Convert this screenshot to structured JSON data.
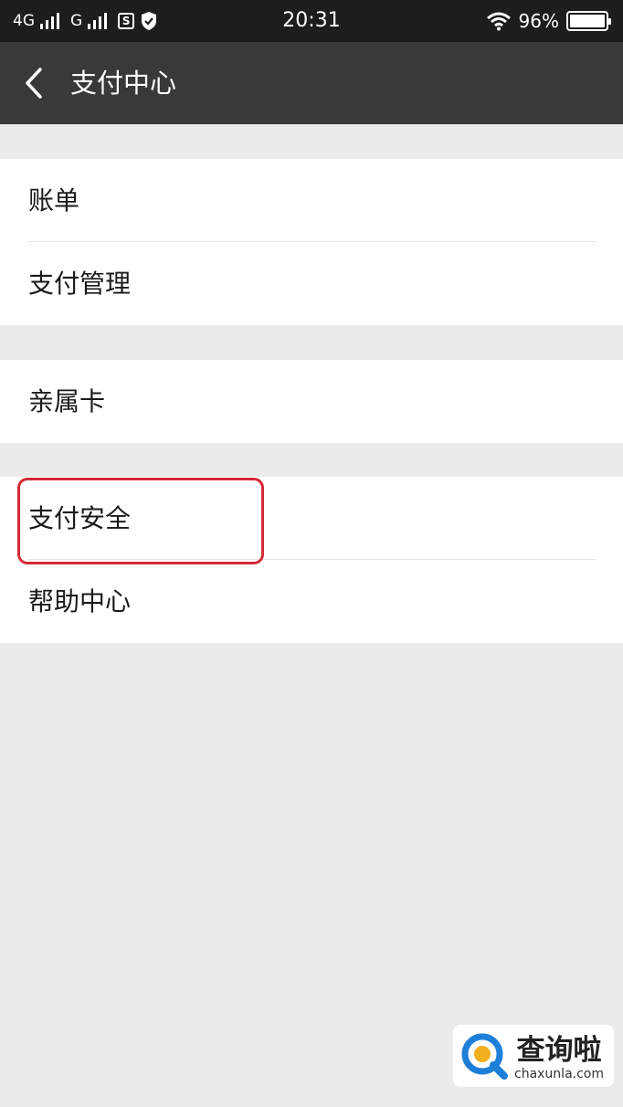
{
  "status_bar": {
    "network_1": "4G",
    "network_2": "G",
    "time": "20:31",
    "battery": "96%",
    "battery_level": 0.96,
    "sim_badge": "S"
  },
  "nav": {
    "back_icon": "chevron-left-icon",
    "title": "支付中心"
  },
  "menu": {
    "group1": [
      {
        "label": "账单"
      },
      {
        "label": "支付管理"
      }
    ],
    "group2": [
      {
        "label": "亲属卡"
      }
    ],
    "group3": [
      {
        "label": "支付安全"
      },
      {
        "label": "帮助中心"
      }
    ]
  },
  "highlight_color": "#d32a38",
  "watermark": {
    "brand": "查询啦",
    "url": "chaxunla.com"
  }
}
